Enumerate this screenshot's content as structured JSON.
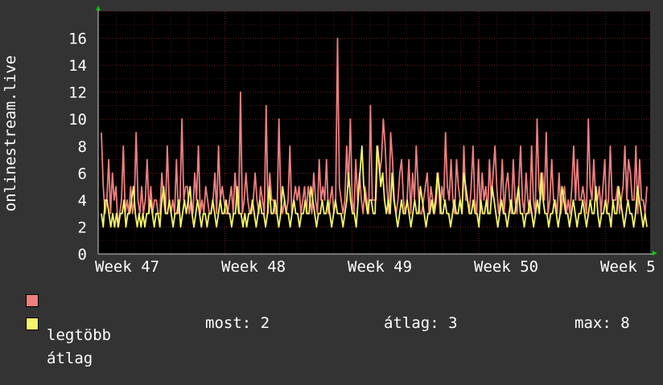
{
  "chart_data": {
    "type": "line",
    "ylabel": "onlinestream.live",
    "ylim": [
      0,
      18
    ],
    "yticks": [
      0,
      2,
      4,
      6,
      8,
      10,
      12,
      14,
      16
    ],
    "xtick_labels": [
      "Week 47",
      "Week 48",
      "Week 49",
      "Week 50",
      "Week 5"
    ],
    "grid": true,
    "legend_position": "bottom-left",
    "colors": {
      "max_series": "#f07f7f",
      "avg_series": "#f5f56a",
      "background": "#333333",
      "plot_bg": "#000000",
      "grid": "#5a1e1e"
    },
    "series": [
      {
        "name": "legtöbb",
        "color": "#f07f7f",
        "values": [
          9,
          5,
          3,
          4,
          7,
          3,
          6,
          4,
          5,
          2,
          3,
          4,
          8,
          3,
          4,
          3,
          5,
          3,
          4,
          9,
          4,
          3,
          5,
          3,
          4,
          7,
          3,
          5,
          3,
          4,
          4,
          3,
          3,
          6,
          4,
          3,
          8,
          4,
          3,
          4,
          3,
          7,
          3,
          4,
          10,
          4,
          5,
          5,
          3,
          4,
          3,
          6,
          4,
          8,
          3,
          4,
          3,
          5,
          4,
          3,
          3,
          4,
          6,
          3,
          8,
          4,
          5,
          4,
          3,
          3,
          4,
          5,
          3,
          6,
          4,
          3,
          12,
          3,
          4,
          6,
          4,
          3,
          3,
          4,
          6,
          4,
          3,
          5,
          4,
          3,
          11,
          3,
          6,
          4,
          4,
          3,
          3,
          10,
          4,
          3,
          4,
          3,
          4,
          8,
          3,
          4,
          5,
          4,
          5,
          3,
          4,
          5,
          3,
          5,
          4,
          3,
          6,
          4,
          3,
          7,
          4,
          5,
          4,
          7,
          3,
          4,
          5,
          3,
          4,
          16,
          5,
          4,
          3,
          4,
          8,
          5,
          10,
          4,
          3,
          7,
          4,
          6,
          4,
          3,
          5,
          4,
          3,
          11,
          4,
          4,
          4,
          8,
          6,
          7,
          10,
          8,
          5,
          3,
          9,
          7,
          4,
          3,
          4,
          6,
          7,
          4,
          3,
          4,
          7,
          3,
          6,
          4,
          8,
          5,
          3,
          3,
          4,
          5,
          6,
          3,
          5,
          4,
          3,
          4,
          6,
          3,
          5,
          4,
          9,
          5,
          4,
          7,
          4,
          3,
          7,
          5,
          4,
          3,
          8,
          4,
          4,
          3,
          5,
          8,
          4,
          3,
          7,
          3,
          6,
          4,
          5,
          3,
          7,
          4,
          6,
          8,
          5,
          3,
          4,
          7,
          3,
          5,
          6,
          4,
          3,
          7,
          4,
          3,
          5,
          8,
          4,
          3,
          6,
          4,
          3,
          8,
          4,
          3,
          10,
          5,
          4,
          6,
          4,
          9,
          3,
          4,
          7,
          4,
          4,
          3,
          6,
          3,
          4,
          5,
          3,
          4,
          3,
          5,
          8,
          4,
          7,
          4,
          4,
          5,
          4,
          3,
          10,
          5,
          4,
          7,
          4,
          4,
          5,
          3,
          5,
          7,
          3,
          4,
          8,
          4,
          4,
          4,
          5,
          3,
          4,
          5,
          8,
          4,
          7,
          6,
          4,
          4,
          8,
          3,
          7,
          4,
          4,
          3,
          5
        ]
      },
      {
        "name": "átlag",
        "color": "#f5f56a",
        "values": [
          3,
          2,
          4,
          4,
          3,
          2,
          3,
          2,
          3,
          2,
          3,
          3,
          4,
          2,
          3,
          3,
          4,
          5,
          3,
          2,
          3,
          2,
          3,
          2,
          3,
          3,
          4,
          3,
          2,
          3,
          3,
          2,
          4,
          5,
          3,
          3,
          4,
          3,
          2,
          3,
          3,
          4,
          2,
          3,
          4,
          3,
          4,
          5,
          3,
          2,
          3,
          4,
          3,
          2,
          3,
          3,
          2,
          3,
          3,
          4,
          3,
          2,
          3,
          4,
          3,
          3,
          4,
          3,
          3,
          2,
          3,
          3,
          5,
          3,
          3,
          2,
          3,
          2,
          3,
          3,
          4,
          3,
          2,
          3,
          4,
          3,
          3,
          2,
          3,
          5,
          3,
          3,
          4,
          3,
          2,
          3,
          5,
          4,
          3,
          3,
          2,
          3,
          4,
          3,
          3,
          2,
          3,
          3,
          4,
          3,
          3,
          5,
          4,
          3,
          2,
          3,
          3,
          4,
          3,
          3,
          4,
          3,
          2,
          3,
          4,
          3,
          3,
          3,
          2,
          3,
          4,
          6,
          4,
          3,
          3,
          2,
          4,
          6,
          8,
          5,
          4,
          3,
          4,
          4,
          3,
          3,
          8,
          7,
          5,
          6,
          4,
          3,
          4,
          3,
          6,
          4,
          3,
          2,
          3,
          4,
          3,
          3,
          4,
          3,
          2,
          3,
          4,
          3,
          3,
          5,
          4,
          3,
          2,
          3,
          3,
          4,
          3,
          4,
          6,
          5,
          3,
          3,
          4,
          3,
          3,
          2,
          3,
          4,
          3,
          3,
          4,
          3,
          6,
          5,
          4,
          3,
          3,
          4,
          3,
          3,
          2,
          4,
          3,
          3,
          4,
          3,
          3,
          5,
          4,
          3,
          2,
          3,
          4,
          3,
          3,
          2,
          3,
          4,
          3,
          3,
          4,
          5,
          3,
          3,
          2,
          3,
          3,
          4,
          3,
          2,
          3,
          4,
          3,
          6,
          4,
          3,
          3,
          2,
          3,
          3,
          4,
          3,
          2,
          3,
          5,
          4,
          3,
          3,
          2,
          3,
          4,
          3,
          2,
          3,
          3,
          4,
          3,
          2,
          3,
          4,
          3,
          3,
          5,
          3,
          2,
          3,
          3,
          4,
          3,
          3,
          2,
          4,
          3,
          3,
          5,
          4,
          3,
          2,
          3,
          4,
          3,
          3,
          2,
          3,
          5,
          4,
          3,
          2,
          3,
          2
        ]
      }
    ]
  },
  "legend": {
    "items": [
      {
        "label": "legtöbb",
        "color": "#f07f7f"
      },
      {
        "label": "átlag",
        "color": "#f5f56a"
      }
    ],
    "stats": {
      "now": "most: 2",
      "avg": "átlag: 3",
      "max": "max: 8"
    }
  }
}
